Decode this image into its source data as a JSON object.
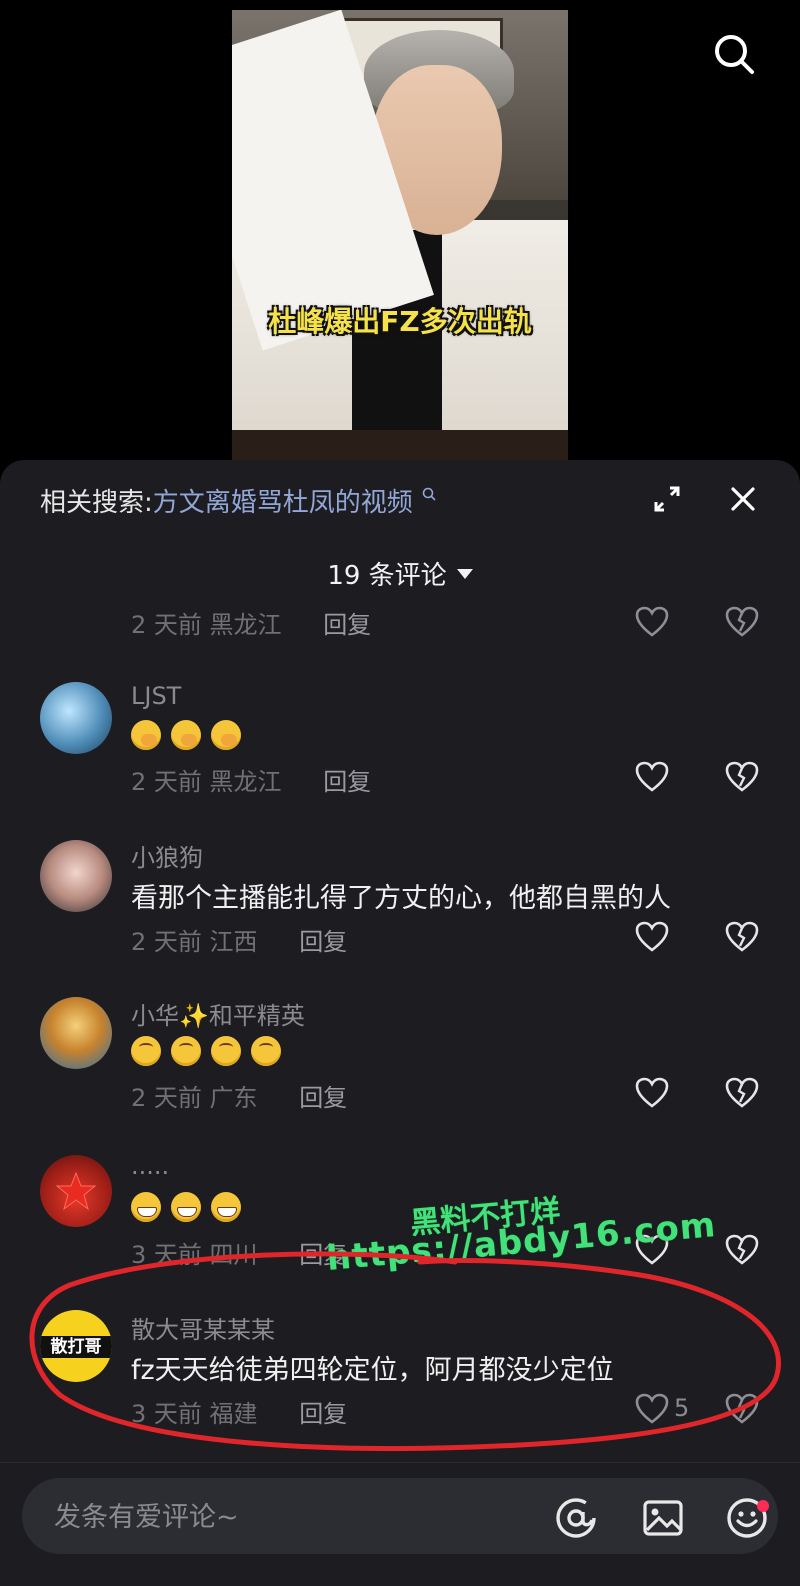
{
  "video": {
    "caption": "杜峰爆出FZ多次出轨"
  },
  "sheet": {
    "related_prefix": "相关搜索:",
    "related_query": "方文离婚骂杜凤的视频",
    "comment_count": "19 条评论"
  },
  "comments": [
    {
      "user": "",
      "text": "",
      "time": "2 天前",
      "region": "黑龙江",
      "reply": "回复",
      "likes": ""
    },
    {
      "user": "LJST",
      "text": "",
      "emojis": [
        "hand",
        "hand",
        "hand"
      ],
      "time": "2 天前",
      "region": "黑龙江",
      "reply": "回复",
      "likes": ""
    },
    {
      "user": "小狼狗",
      "text": "看那个主播能扎得了方丈的心，他都自黑的人",
      "time": "2 天前",
      "region": "江西",
      "reply": "回复",
      "likes": ""
    },
    {
      "user": "小华✨和平精英",
      "text": "",
      "emojis": [
        "upside",
        "upside",
        "upside",
        "upside"
      ],
      "time": "2 天前",
      "region": "广东",
      "reply": "回复",
      "likes": ""
    },
    {
      "user": ".....",
      "text": "",
      "emojis": [
        "grin",
        "grin",
        "grin"
      ],
      "time": "3 天前",
      "region": "四川",
      "reply": "回复",
      "likes": ""
    },
    {
      "user": "散大哥某某某",
      "text": "fz天天给徒弟四轮定位，阿月都没少定位",
      "time": "3 天前",
      "region": "福建",
      "reply": "回复",
      "likes": "5"
    }
  ],
  "avatar_labels": {
    "sdg": "散打哥"
  },
  "watermark": {
    "line1": "黑料不打烊",
    "line2": "https://abdy16.com"
  },
  "input": {
    "placeholder": "发条有爱评论~"
  },
  "colors": {
    "sheet_bg": "#1c1c21",
    "link": "#93a7d7",
    "watermark": "#44e07a",
    "annotation": "#e0262b",
    "notification_dot": "#fe2c55"
  }
}
